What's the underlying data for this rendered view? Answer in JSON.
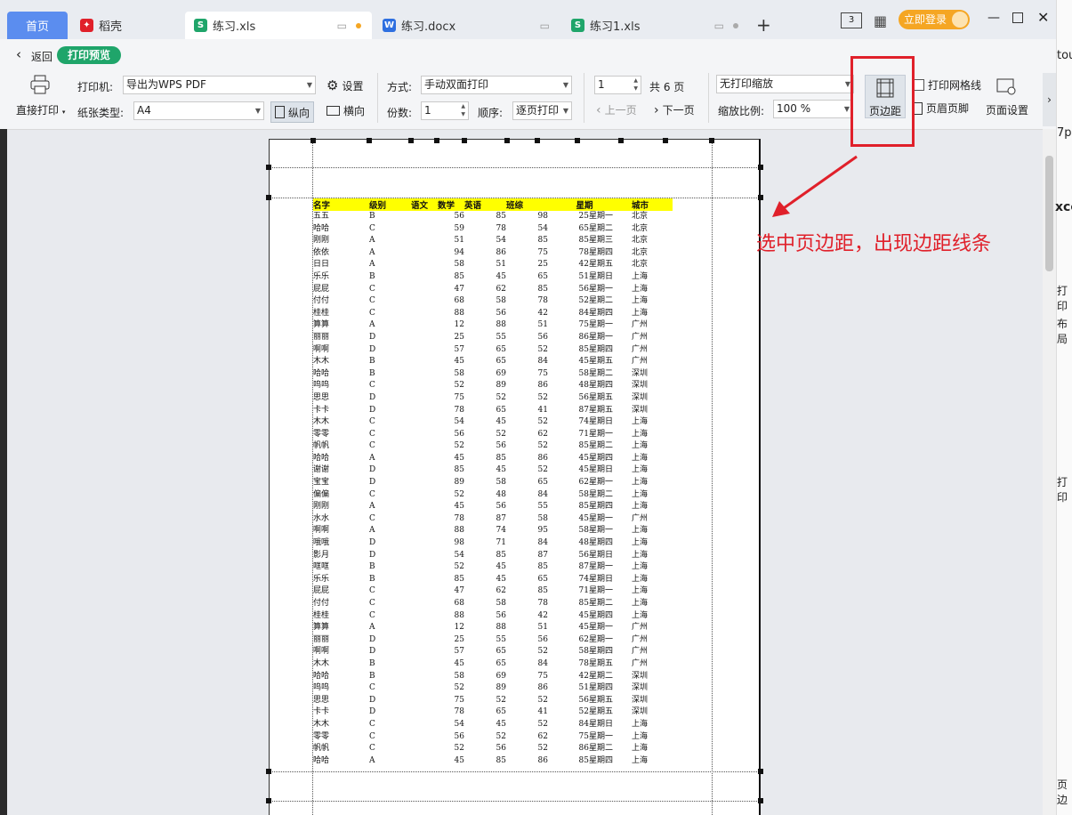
{
  "tabs": [
    {
      "label": "首页",
      "active": true
    },
    {
      "label": "稻壳"
    },
    {
      "label": "练习.xls",
      "selected": true
    },
    {
      "label": "练习.docx"
    },
    {
      "label": "练习1.xls"
    }
  ],
  "titlebar": {
    "login_label": "立即登录",
    "screen_btn": "3"
  },
  "nav": {
    "back_label": "返回",
    "mode_badge": "打印预览"
  },
  "toolbar": {
    "direct_print": "直接打印",
    "printer_label": "打印机:",
    "printer_value": "导出为WPS PDF",
    "settings_label": "设置",
    "paper_label": "纸张类型:",
    "paper_value": "A4",
    "portrait_label": "纵向",
    "landscape_label": "横向",
    "method_label": "方式:",
    "method_value": "手动双面打印",
    "copies_label": "份数:",
    "copies_value": "1",
    "order_label": "顺序:",
    "order_value": "逐页打印",
    "page_value": "1",
    "total_pages": "共 6 页",
    "prev_page": "上一页",
    "next_page": "下一页",
    "scale_mode": "无打印缩放",
    "scale_label": "缩放比例:",
    "scale_value": "100 %",
    "margins_label": "页边距",
    "gridlines_label": "打印网格线",
    "header_footer_label": "页眉页脚",
    "page_setup_label": "页面设置"
  },
  "annotation": {
    "text": "选中页边距，出现边距线条"
  },
  "right_fragments": [
    "tout",
    "7p:",
    "xce",
    "打印",
    "布局",
    "打印",
    "页边"
  ],
  "sheet": {
    "headers": [
      "名字",
      "级别",
      "语文",
      "数学",
      "英语",
      "班综",
      "星期",
      "城市"
    ],
    "rows": [
      [
        "五五",
        "B",
        "",
        "56",
        "85",
        "98",
        "25",
        "星期一",
        "北京"
      ],
      [
        "哈哈",
        "C",
        "",
        "59",
        "78",
        "54",
        "65",
        "星期二",
        "北京"
      ],
      [
        "刚刚",
        "A",
        "",
        "51",
        "54",
        "85",
        "85",
        "星期三",
        "北京"
      ],
      [
        "依依",
        "A",
        "",
        "94",
        "86",
        "75",
        "78",
        "星期四",
        "北京"
      ],
      [
        "日日",
        "A",
        "",
        "58",
        "51",
        "25",
        "42",
        "星期五",
        "北京"
      ],
      [
        "乐乐",
        "B",
        "",
        "85",
        "45",
        "65",
        "51",
        "星期日",
        "上海"
      ],
      [
        "屁屁",
        "C",
        "",
        "47",
        "62",
        "85",
        "56",
        "星期一",
        "上海"
      ],
      [
        "付付",
        "C",
        "",
        "68",
        "58",
        "78",
        "52",
        "星期二",
        "上海"
      ],
      [
        "桂桂",
        "C",
        "",
        "88",
        "56",
        "42",
        "84",
        "星期四",
        "上海"
      ],
      [
        "算算",
        "A",
        "",
        "12",
        "88",
        "51",
        "75",
        "星期一",
        "广州"
      ],
      [
        "丽丽",
        "D",
        "",
        "25",
        "55",
        "56",
        "86",
        "星期一",
        "广州"
      ],
      [
        "啊啊",
        "D",
        "",
        "57",
        "65",
        "52",
        "85",
        "星期四",
        "广州"
      ],
      [
        "木木",
        "B",
        "",
        "45",
        "65",
        "84",
        "45",
        "星期五",
        "广州"
      ],
      [
        "哈哈",
        "B",
        "",
        "58",
        "69",
        "75",
        "58",
        "星期二",
        "深圳"
      ],
      [
        "呜呜",
        "C",
        "",
        "52",
        "89",
        "86",
        "48",
        "星期四",
        "深圳"
      ],
      [
        "思思",
        "D",
        "",
        "75",
        "52",
        "52",
        "56",
        "星期五",
        "深圳"
      ],
      [
        "卡卡",
        "D",
        "",
        "78",
        "65",
        "41",
        "87",
        "星期五",
        "深圳"
      ],
      [
        "木木",
        "C",
        "",
        "54",
        "45",
        "52",
        "74",
        "星期日",
        "上海"
      ],
      [
        "零零",
        "C",
        "",
        "56",
        "52",
        "62",
        "71",
        "星期一",
        "上海"
      ],
      [
        "帆帆",
        "C",
        "",
        "52",
        "56",
        "52",
        "85",
        "星期二",
        "上海"
      ],
      [
        "哈哈",
        "A",
        "",
        "45",
        "85",
        "86",
        "45",
        "星期四",
        "上海"
      ],
      [
        "谢谢",
        "D",
        "",
        "85",
        "45",
        "52",
        "45",
        "星期日",
        "上海"
      ],
      [
        "宝宝",
        "D",
        "",
        "89",
        "58",
        "65",
        "62",
        "星期一",
        "上海"
      ],
      [
        "偏偏",
        "C",
        "",
        "52",
        "48",
        "84",
        "58",
        "星期二",
        "上海"
      ],
      [
        "刚刚",
        "A",
        "",
        "45",
        "56",
        "55",
        "85",
        "星期四",
        "上海"
      ],
      [
        "水水",
        "C",
        "",
        "78",
        "87",
        "58",
        "45",
        "星期一",
        "广州"
      ],
      [
        "啊啊",
        "A",
        "",
        "88",
        "74",
        "95",
        "58",
        "星期一",
        "上海"
      ],
      [
        "哦哦",
        "D",
        "",
        "98",
        "71",
        "84",
        "48",
        "星期四",
        "上海"
      ],
      [
        "影月",
        "D",
        "",
        "54",
        "85",
        "87",
        "56",
        "星期日",
        "上海"
      ],
      [
        "哐哐",
        "B",
        "",
        "52",
        "45",
        "85",
        "87",
        "星期一",
        "上海"
      ],
      [
        "乐乐",
        "B",
        "",
        "85",
        "45",
        "65",
        "74",
        "星期日",
        "上海"
      ],
      [
        "屁屁",
        "C",
        "",
        "47",
        "62",
        "85",
        "71",
        "星期一",
        "上海"
      ],
      [
        "付付",
        "C",
        "",
        "68",
        "58",
        "78",
        "85",
        "星期二",
        "上海"
      ],
      [
        "桂桂",
        "C",
        "",
        "88",
        "56",
        "42",
        "45",
        "星期四",
        "上海"
      ],
      [
        "算算",
        "A",
        "",
        "12",
        "88",
        "51",
        "45",
        "星期一",
        "广州"
      ],
      [
        "丽丽",
        "D",
        "",
        "25",
        "55",
        "56",
        "62",
        "星期一",
        "广州"
      ],
      [
        "啊啊",
        "D",
        "",
        "57",
        "65",
        "52",
        "58",
        "星期四",
        "广州"
      ],
      [
        "木木",
        "B",
        "",
        "45",
        "65",
        "84",
        "78",
        "星期五",
        "广州"
      ],
      [
        "哈哈",
        "B",
        "",
        "58",
        "69",
        "75",
        "42",
        "星期二",
        "深圳"
      ],
      [
        "呜呜",
        "C",
        "",
        "52",
        "89",
        "86",
        "51",
        "星期四",
        "深圳"
      ],
      [
        "思思",
        "D",
        "",
        "75",
        "52",
        "52",
        "56",
        "星期五",
        "深圳"
      ],
      [
        "卡卡",
        "D",
        "",
        "78",
        "65",
        "41",
        "52",
        "星期五",
        "深圳"
      ],
      [
        "木木",
        "C",
        "",
        "54",
        "45",
        "52",
        "84",
        "星期日",
        "上海"
      ],
      [
        "零零",
        "C",
        "",
        "56",
        "52",
        "62",
        "75",
        "星期一",
        "上海"
      ],
      [
        "帆帆",
        "C",
        "",
        "52",
        "56",
        "52",
        "86",
        "星期二",
        "上海"
      ],
      [
        "哈哈",
        "A",
        "",
        "45",
        "85",
        "86",
        "85",
        "星期四",
        "上海"
      ]
    ]
  }
}
